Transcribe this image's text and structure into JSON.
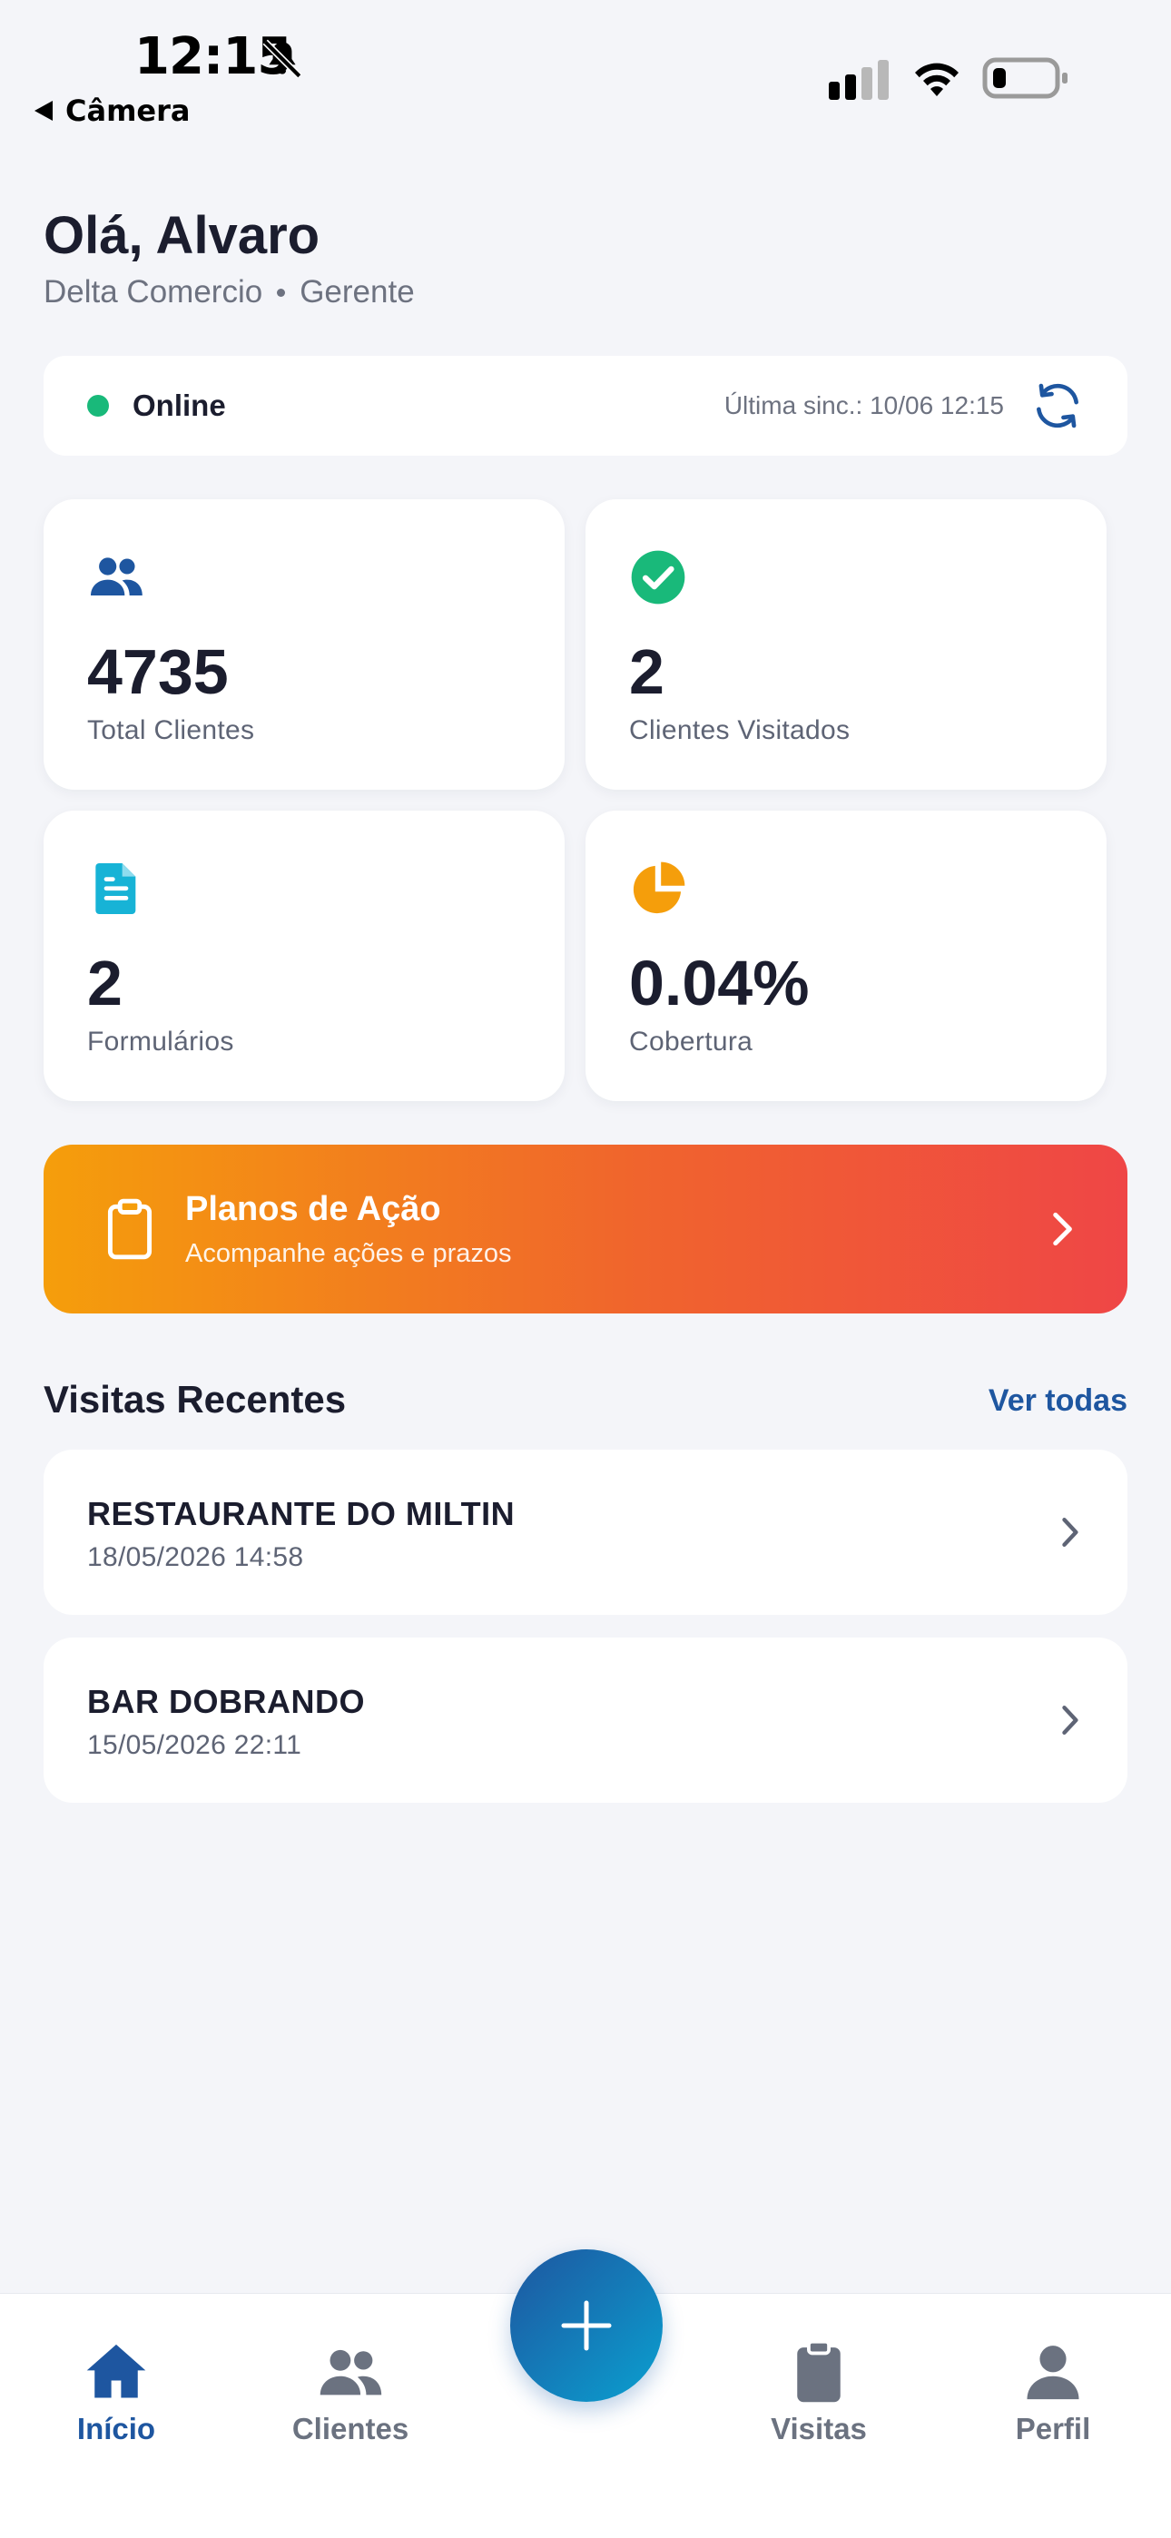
{
  "status_bar": {
    "time": "12:15",
    "back_label": "Câmera"
  },
  "header": {
    "greeting": "Olá, Alvaro",
    "company": "Delta Comercio",
    "role": "Gerente"
  },
  "sync": {
    "status": "Online",
    "last_sync": "Última sinc.: 10/06 12:15"
  },
  "stats": [
    {
      "value": "4735",
      "label": "Total Clientes",
      "icon": "users-icon",
      "color": "#1e56a0"
    },
    {
      "value": "2",
      "label": "Clientes Visitados",
      "icon": "check-circle-icon",
      "color": "#19b97a"
    },
    {
      "value": "2",
      "label": "Formulários",
      "icon": "document-icon",
      "color": "#17b3d6"
    },
    {
      "value": "0.04%",
      "label": "Cobertura",
      "icon": "pie-chart-icon",
      "color": "#f59e0b"
    }
  ],
  "action_banner": {
    "title": "Planos de Ação",
    "subtitle": "Acompanhe ações e prazos",
    "gradient": [
      "#f59e0b",
      "#ef4646"
    ]
  },
  "recent_visits": {
    "title": "Visitas Recentes",
    "see_all": "Ver todas",
    "items": [
      {
        "name": "RESTAURANTE DO MILTIN",
        "date": "18/05/2026 14:58"
      },
      {
        "name": "BAR DOBRANDO",
        "date": "15/05/2026 22:11"
      }
    ]
  },
  "bottom_nav": {
    "items": [
      {
        "label": "Início",
        "icon": "home-icon",
        "active": true
      },
      {
        "label": "Clientes",
        "icon": "users-icon",
        "active": false
      },
      {
        "label": "Visitas",
        "icon": "clipboard-icon",
        "active": false
      },
      {
        "label": "Perfil",
        "icon": "user-icon",
        "active": false
      }
    ],
    "fab_icon": "plus-icon"
  },
  "colors": {
    "primary": "#1e56a0",
    "online": "#19b97a",
    "background": "#f4f5f9"
  }
}
